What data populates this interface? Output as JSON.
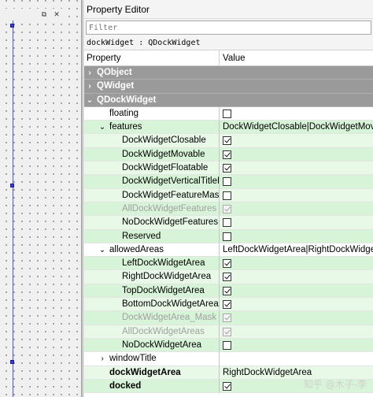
{
  "designer": {
    "float_icon": "⧉",
    "close_icon": "✕"
  },
  "panel": {
    "title": "Property Editor",
    "filter_placeholder": "Filter",
    "object_line": "dockWidget : QDockWidget",
    "col_property": "Property",
    "col_value": "Value"
  },
  "rows": [
    {
      "type": "group",
      "label": "QObject",
      "arrow": "›"
    },
    {
      "type": "group",
      "label": "QWidget",
      "arrow": "›"
    },
    {
      "type": "group",
      "label": "QDockWidget",
      "arrow": "⌄"
    },
    {
      "label": "floating",
      "indent": 1,
      "checkbox": true,
      "checked": false,
      "bg": "white"
    },
    {
      "label": "features",
      "indent": 1,
      "arrow": "⌄",
      "value": "DockWidgetClosable|DockWidgetMovable",
      "bg": "green"
    },
    {
      "label": "DockWidgetClosable",
      "indent": 2,
      "checkbox": true,
      "checked": true,
      "bg": "green2"
    },
    {
      "label": "DockWidgetMovable",
      "indent": 2,
      "checkbox": true,
      "checked": true,
      "bg": "green"
    },
    {
      "label": "DockWidgetFloatable",
      "indent": 2,
      "checkbox": true,
      "checked": true,
      "bg": "green2"
    },
    {
      "label": "DockWidgetVerticalTitleBar",
      "indent": 2,
      "checkbox": true,
      "checked": false,
      "bg": "green"
    },
    {
      "label": "DockWidgetFeatureMask",
      "indent": 2,
      "checkbox": true,
      "checked": false,
      "bg": "green2"
    },
    {
      "label": "AllDockWidgetFeatures",
      "indent": 2,
      "checkbox": true,
      "checked": true,
      "disabled": true,
      "bg": "green"
    },
    {
      "label": "NoDockWidgetFeatures",
      "indent": 2,
      "checkbox": true,
      "checked": false,
      "bg": "green2"
    },
    {
      "label": "Reserved",
      "indent": 2,
      "checkbox": true,
      "checked": false,
      "bg": "green"
    },
    {
      "label": "allowedAreas",
      "indent": 1,
      "arrow": "⌄",
      "value": "LeftDockWidgetArea|RightDockWidgetArea",
      "bg": "white"
    },
    {
      "label": "LeftDockWidgetArea",
      "indent": 2,
      "checkbox": true,
      "checked": true,
      "bg": "green"
    },
    {
      "label": "RightDockWidgetArea",
      "indent": 2,
      "checkbox": true,
      "checked": true,
      "bg": "green2"
    },
    {
      "label": "TopDockWidgetArea",
      "indent": 2,
      "checkbox": true,
      "checked": true,
      "bg": "green"
    },
    {
      "label": "BottomDockWidgetArea",
      "indent": 2,
      "checkbox": true,
      "checked": true,
      "bg": "green2"
    },
    {
      "label": "DockWidgetArea_Mask",
      "indent": 2,
      "checkbox": true,
      "checked": true,
      "disabled": true,
      "bg": "green"
    },
    {
      "label": "AllDockWidgetAreas",
      "indent": 2,
      "checkbox": true,
      "checked": true,
      "disabled": true,
      "bg": "green2"
    },
    {
      "label": "NoDockWidgetArea",
      "indent": 2,
      "checkbox": true,
      "checked": false,
      "bg": "green"
    },
    {
      "label": "windowTitle",
      "indent": 1,
      "arrow": "›",
      "value": "",
      "bg": "white"
    },
    {
      "label": "dockWidgetArea",
      "indent": 1,
      "bold": true,
      "value": "RightDockWidgetArea",
      "bg": "green2"
    },
    {
      "label": "docked",
      "indent": 1,
      "bold": true,
      "checkbox": true,
      "checked": true,
      "bg": "green"
    }
  ],
  "watermark": "知乎 @木子-李"
}
